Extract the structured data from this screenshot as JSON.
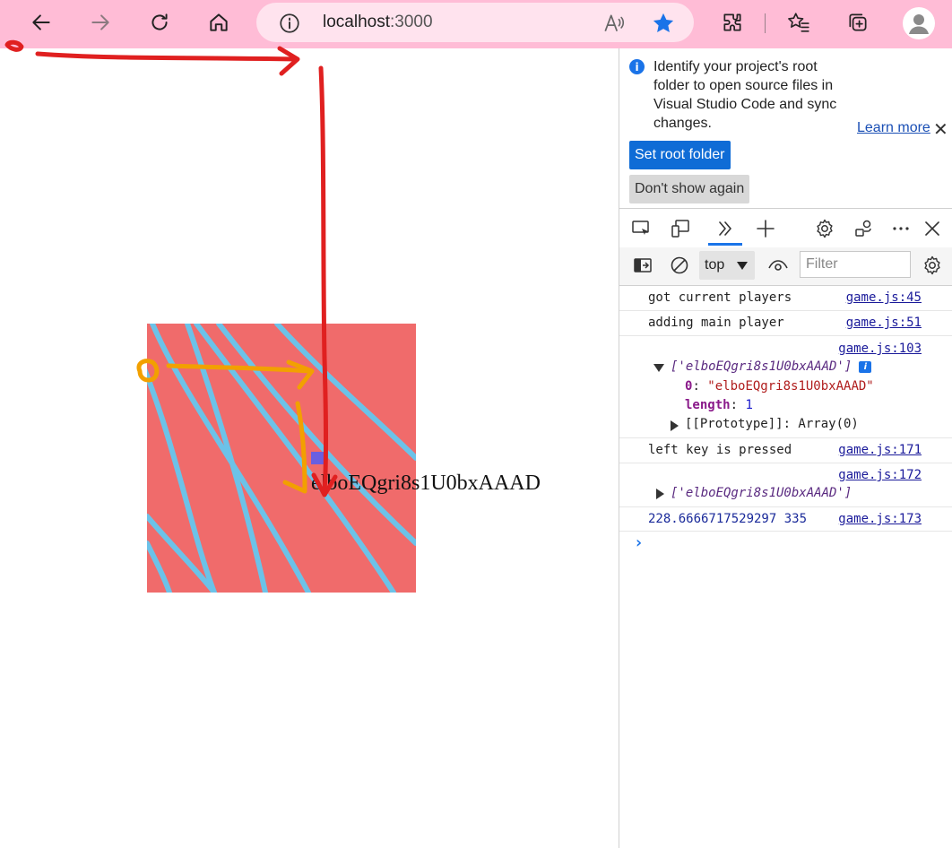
{
  "browser": {
    "url_host": "localhost",
    "url_port": ":3000",
    "toolbar_color": "#ffbcd6",
    "icons": [
      "back-icon",
      "forward-icon",
      "refresh-icon",
      "home-icon",
      "site-info-icon",
      "read-aloud-icon",
      "favorite-star-icon",
      "extensions-icon",
      "favorites-icon",
      "collections-icon",
      "profile-icon"
    ]
  },
  "page": {
    "player_name": "elboEQgri8s1U0bxAAAD",
    "canvas_color": "#f06b6b",
    "stripe_color": "#6cc2e8",
    "player_color": "#6a5fe0"
  },
  "devtools": {
    "infobar": {
      "message": "Identify your project's root folder to open source files in Visual Studio Code and sync changes.",
      "learn_more": "Learn more",
      "set_root": "Set root folder",
      "dont_show": "Don't show again"
    },
    "console": {
      "context": "top",
      "filter_placeholder": "Filter",
      "entries": [
        {
          "message": "got current players",
          "source": "game.js:45"
        },
        {
          "message": "adding main player",
          "source": "game.js:51"
        },
        {
          "source": "game.js:103",
          "array_preview": "['elboEQgri8s1U0bxAAAD']",
          "badge": "i",
          "props": [
            {
              "key": "0",
              "sep": ": ",
              "value": "\"elboEQgri8s1U0bxAAAD\""
            },
            {
              "key": "length",
              "sep": ": ",
              "value": "1"
            }
          ],
          "prototype": "[[Prototype]]: Array(0)"
        },
        {
          "message": "left key is pressed",
          "source": "game.js:171"
        },
        {
          "source": "game.js:172",
          "array_preview": "['elboEQgri8s1U0bxAAAD']"
        },
        {
          "message": "228.6666717529297 335",
          "source": "game.js:173"
        }
      ],
      "prompt": "›"
    }
  }
}
